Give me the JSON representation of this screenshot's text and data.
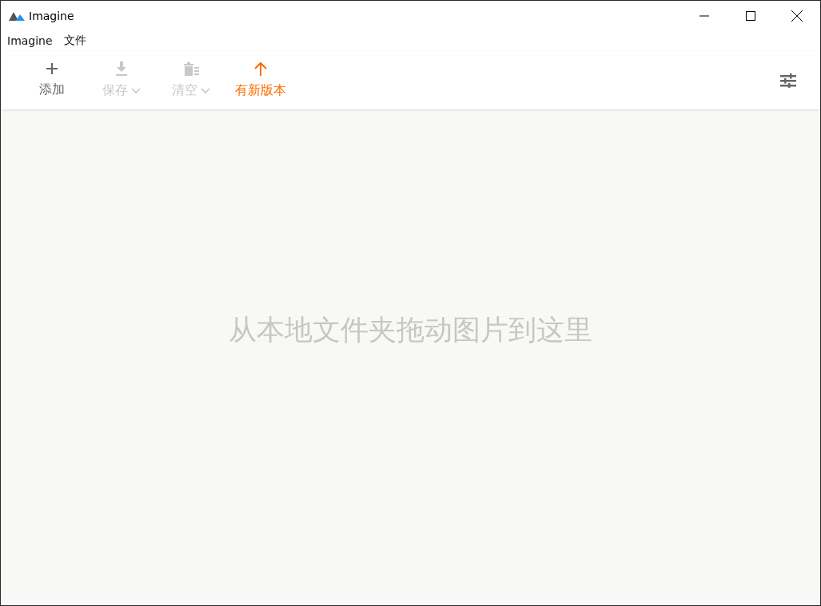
{
  "window": {
    "title": "Imagine"
  },
  "menu": [
    "Imagine",
    "文件"
  ],
  "toolbar": [
    {
      "kind": "add",
      "label": "添加",
      "disabled": false,
      "dropdown": false
    },
    {
      "kind": "save",
      "label": "保存",
      "disabled": true,
      "dropdown": true
    },
    {
      "kind": "clear",
      "label": "清空",
      "disabled": true,
      "dropdown": true
    },
    {
      "kind": "update",
      "label": "有新版本",
      "disabled": false,
      "dropdown": false
    }
  ],
  "drop_hint": "从本地文件夹拖动图片到这里"
}
